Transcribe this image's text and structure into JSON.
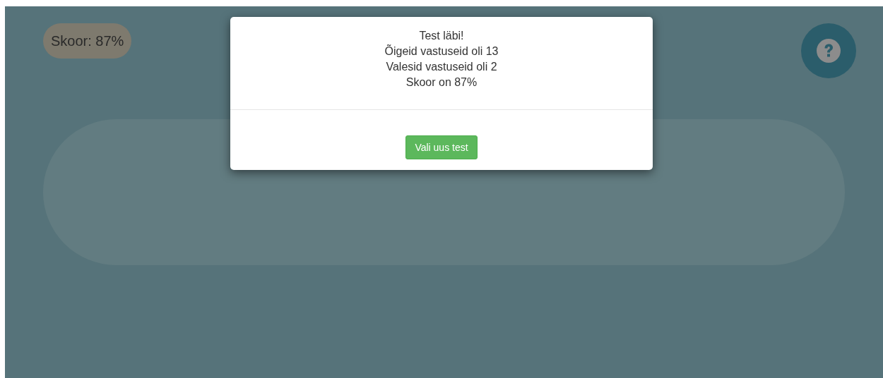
{
  "score_badge": "Skoor: 87%",
  "dialog": {
    "lines": [
      "Test läbi!",
      "Õigeid vastuseid oli 13",
      "Valesid vastuseid oli 2",
      "Skoor on 87%"
    ],
    "button": "Vali uus test"
  }
}
